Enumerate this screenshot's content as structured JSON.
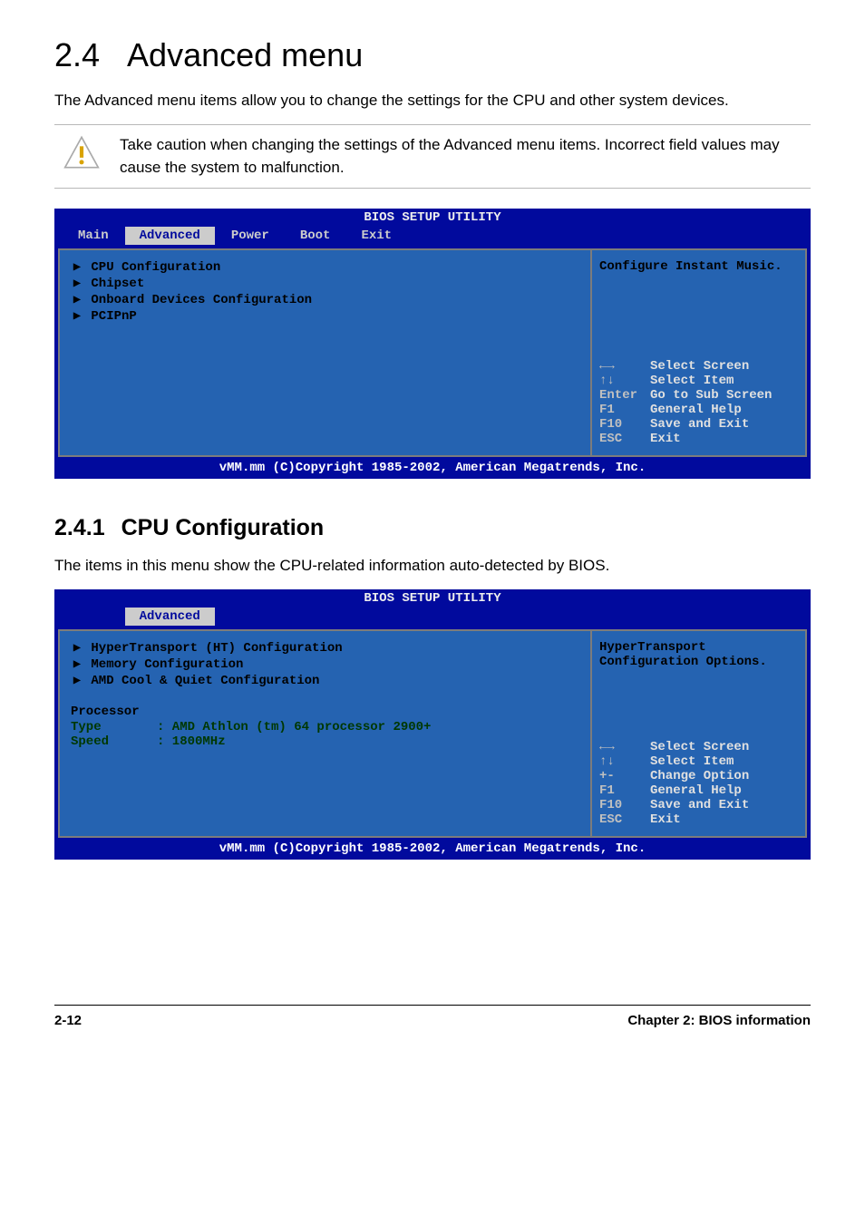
{
  "section": {
    "number": "2.4",
    "title": "Advanced menu",
    "intro": "The Advanced menu items allow you to change the settings for the CPU and other system devices."
  },
  "alert": {
    "text": "Take caution when changing the settings of the Advanced menu items. Incorrect field values may cause the system to malfunction."
  },
  "bios1": {
    "title": "BIOS SETUP UTILITY",
    "menus": [
      "Main",
      "Advanced",
      "Power",
      "Boot",
      "Exit"
    ],
    "selectedMenu": "Advanced",
    "left_items": [
      "CPU Configuration",
      "Chipset",
      "Onboard Devices Configuration",
      "PCIPnP"
    ],
    "help": "Configure Instant Music.",
    "keys": [
      {
        "k": "←→",
        "l": "Select Screen"
      },
      {
        "k": "↑↓",
        "l": "Select Item"
      },
      {
        "k": "Enter",
        "l": "Go to Sub Screen"
      },
      {
        "k": "F1",
        "l": "General Help"
      },
      {
        "k": "F10",
        "l": "Save and Exit"
      },
      {
        "k": "ESC",
        "l": "Exit"
      }
    ],
    "footer": "vMM.mm (C)Copyright 1985-2002, American Megatrends, Inc."
  },
  "subsection": {
    "number": "2.4.1",
    "title": "CPU Configuration",
    "intro": "The items in this menu show the CPU-related information auto-detected by BIOS."
  },
  "bios2": {
    "title": "BIOS SETUP UTILITY",
    "menus": [
      "Advanced"
    ],
    "left_items": [
      "HyperTransport (HT) Configuration",
      "Memory Configuration",
      "AMD Cool & Quiet Configuration"
    ],
    "processor": {
      "label": "Processor",
      "type_label": "Type",
      "type_value": ": AMD Athlon (tm) 64 processor 2900+",
      "speed_label": "Speed",
      "speed_value": ": 1800MHz"
    },
    "help_line1": "HyperTransport",
    "help_line2": "Configuration Options.",
    "keys": [
      {
        "k": "←→",
        "l": "Select Screen"
      },
      {
        "k": "↑↓",
        "l": "Select Item"
      },
      {
        "k": "+-",
        "l": "Change Option"
      },
      {
        "k": "F1",
        "l": "General Help"
      },
      {
        "k": "F10",
        "l": "Save and Exit"
      },
      {
        "k": "ESC",
        "l": "Exit"
      }
    ],
    "footer": "vMM.mm (C)Copyright 1985-2002, American Megatrends, Inc."
  },
  "footer": {
    "page": "2-12",
    "chapter": "Chapter 2: BIOS information"
  }
}
